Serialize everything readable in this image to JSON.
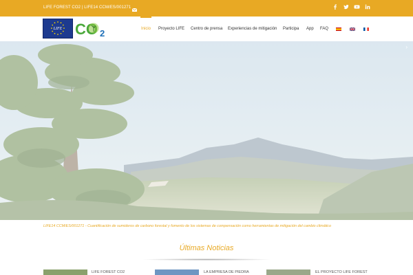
{
  "topbar": {
    "project_text": "LIFE FOREST CO2 | LIFE14 CCM/ES/001271",
    "icons": [
      "mail-icon",
      "facebook-icon",
      "twitter-icon",
      "youtube-icon",
      "linkedin-icon"
    ]
  },
  "header": {
    "logo_eu_text": "LIFE",
    "logo_co2_text": "CO",
    "logo_co2_sub": "2",
    "nav": [
      {
        "label": "Inicio",
        "active": true
      },
      {
        "label": "Proyecto LIFE"
      },
      {
        "label": "Centro de prensa"
      },
      {
        "label": "Experiencias de mitigación"
      },
      {
        "label": "Participa"
      },
      {
        "label": "App"
      },
      {
        "label": "FAQ"
      }
    ],
    "languages": [
      "es-flag-icon",
      "uk-flag-icon",
      "fr-flag-icon"
    ]
  },
  "hero": {
    "next_arrow": "›"
  },
  "caption": "LIFE14 CCM/ES/001271 - Cuantificación de sumideros de carbono forestal y fomento de los sistemas de compensación como herramientas de mitigación del cambio climático",
  "news": {
    "section_title": "Últimas Noticias",
    "items": [
      {
        "title": "LIFE FOREST CO2"
      },
      {
        "title": "LA EMPRESA DE PIEDRA"
      },
      {
        "title": "EL PROYECTO LIFE FOREST"
      }
    ]
  },
  "colors": {
    "accent": "#e8a924",
    "nav_text": "#333333"
  }
}
